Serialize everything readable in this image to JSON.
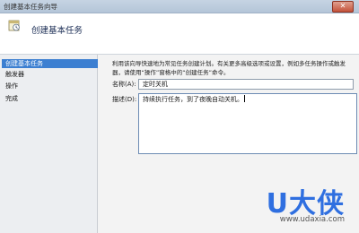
{
  "window": {
    "title": "创建基本任务向导",
    "close_glyph": "✕"
  },
  "header": {
    "title": "创建基本任务",
    "icon": "task-scheduler-icon"
  },
  "steps": [
    {
      "label": "创建基本任务",
      "active": true
    },
    {
      "label": "触发器",
      "active": false
    },
    {
      "label": "操作",
      "active": false
    },
    {
      "label": "完成",
      "active": false
    }
  ],
  "description": {
    "line1": "利用该向导快速地为常见任务创建计划。有关更多高级选项或设置，例如多任务操作或触发",
    "line2": "器，请使用“操作”窗格中的“创建任务”命令。"
  },
  "form": {
    "name_label": "名称(A):",
    "name_value": "定时关机",
    "desc_label": "描述(D):",
    "desc_value": "持续执行任务，到了夜晚自动关机。"
  },
  "watermark": {
    "logo": "U大侠",
    "url": "www.udaxia.com"
  },
  "colors": {
    "accent": "#3c7fd1",
    "watermark": "#2f6fe0"
  }
}
